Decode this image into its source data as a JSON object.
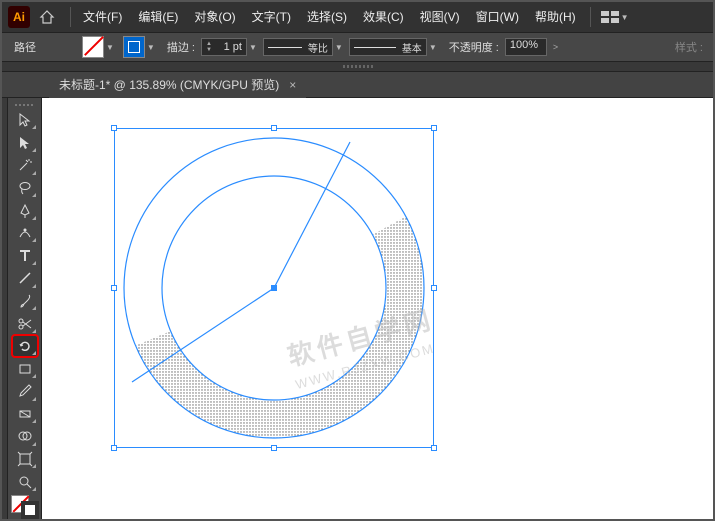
{
  "app": {
    "logo": "Ai"
  },
  "menu": {
    "file": "文件(F)",
    "edit": "编辑(E)",
    "object": "对象(O)",
    "type": "文字(T)",
    "select": "选择(S)",
    "effect": "效果(C)",
    "view": "视图(V)",
    "window": "窗口(W)",
    "help": "帮助(H)"
  },
  "control": {
    "selection_type": "路径",
    "stroke_label": "描边 :",
    "stroke_weight": "1 pt",
    "profile_label": "等比",
    "brush_label": "基本",
    "opacity_label": "不透明度 :",
    "opacity_value": "100%",
    "style_label": "样式 :"
  },
  "tab": {
    "title": "未标题-1* @ 135.89% (CMYK/GPU 预览)",
    "close": "×"
  },
  "watermark": {
    "cn": "软件自学网",
    "en": "WWW.RJZXW.COM"
  },
  "colors": {
    "selection": "#2a8cff",
    "stroke": "#0066cc"
  }
}
